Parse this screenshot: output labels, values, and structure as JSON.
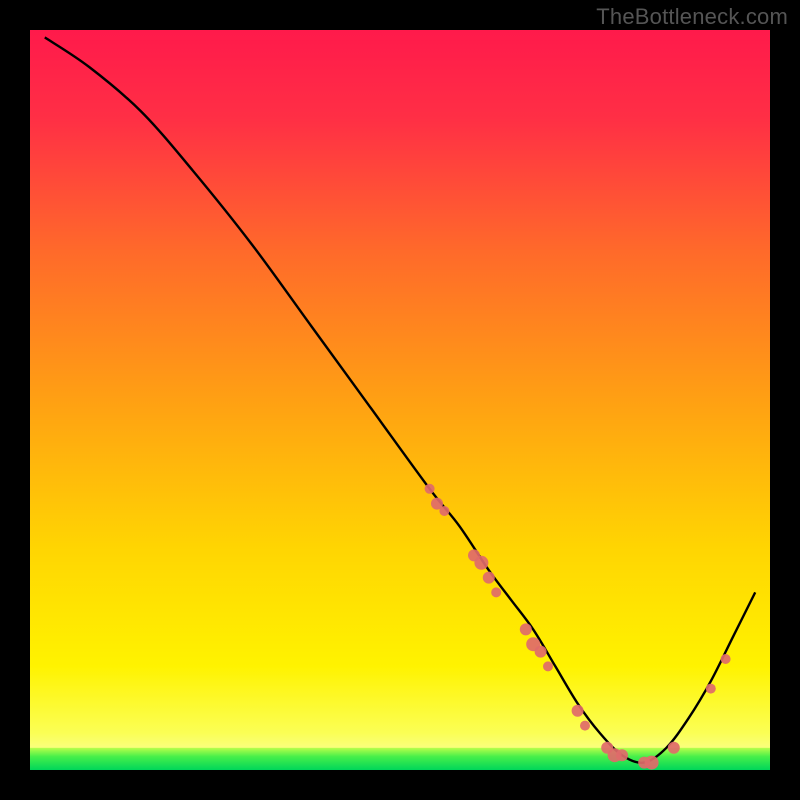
{
  "watermark": "TheBottleneck.com",
  "chart_data": {
    "type": "line",
    "title": "",
    "xlabel": "",
    "ylabel": "",
    "xlim": [
      0,
      100
    ],
    "ylim": [
      0,
      100
    ],
    "background_gradient": {
      "top": "#ff1a4b",
      "mid": "#ffd502",
      "bottom_band": "#00e05a"
    },
    "series": [
      {
        "name": "bottleneck-curve",
        "x": [
          2,
          8,
          15,
          22,
          30,
          38,
          46,
          54,
          58,
          62,
          65,
          68,
          71,
          74,
          77,
          80,
          83,
          86,
          89,
          92,
          95,
          98
        ],
        "y": [
          99,
          95,
          89,
          81,
          71,
          60,
          49,
          38,
          33,
          27,
          23,
          19,
          14,
          9,
          5,
          2,
          1,
          3,
          7,
          12,
          18,
          24
        ]
      }
    ],
    "markers": {
      "name": "highlight-points",
      "color": "#e06a6a",
      "points": [
        {
          "x": 54,
          "y": 38,
          "r": 5
        },
        {
          "x": 55,
          "y": 36,
          "r": 6
        },
        {
          "x": 56,
          "y": 35,
          "r": 5
        },
        {
          "x": 60,
          "y": 29,
          "r": 6
        },
        {
          "x": 61,
          "y": 28,
          "r": 7
        },
        {
          "x": 62,
          "y": 26,
          "r": 6
        },
        {
          "x": 63,
          "y": 24,
          "r": 5
        },
        {
          "x": 67,
          "y": 19,
          "r": 6
        },
        {
          "x": 68,
          "y": 17,
          "r": 7
        },
        {
          "x": 69,
          "y": 16,
          "r": 6
        },
        {
          "x": 70,
          "y": 14,
          "r": 5
        },
        {
          "x": 74,
          "y": 8,
          "r": 6
        },
        {
          "x": 75,
          "y": 6,
          "r": 5
        },
        {
          "x": 78,
          "y": 3,
          "r": 6
        },
        {
          "x": 79,
          "y": 2,
          "r": 7
        },
        {
          "x": 80,
          "y": 2,
          "r": 6
        },
        {
          "x": 83,
          "y": 1,
          "r": 6
        },
        {
          "x": 84,
          "y": 1,
          "r": 7
        },
        {
          "x": 87,
          "y": 3,
          "r": 6
        },
        {
          "x": 92,
          "y": 11,
          "r": 5
        },
        {
          "x": 94,
          "y": 15,
          "r": 5
        }
      ]
    },
    "green_band": {
      "from_y": 0,
      "to_y": 3
    }
  }
}
